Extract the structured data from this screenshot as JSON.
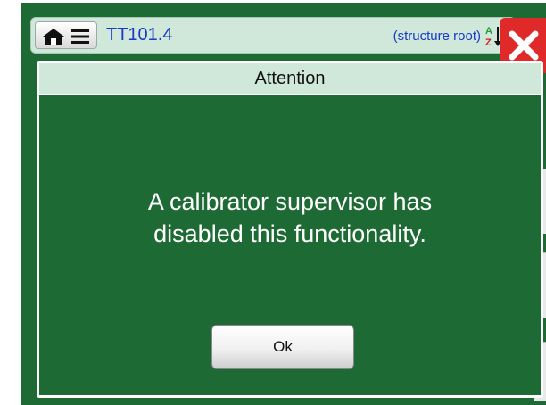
{
  "header": {
    "title": "TT101.4",
    "root_label": "(structure root)",
    "sort_icon_text": "AZ"
  },
  "dialog": {
    "title": "Attention",
    "message_line1": "A calibrator supervisor has",
    "message_line2": "disabled this functionality.",
    "ok_label": "Ok"
  },
  "icons": {
    "home": "home-icon",
    "menu": "menu-icon",
    "sort": "sort-az-icon",
    "close": "close-icon"
  },
  "colors": {
    "background_green": "#1e6a34",
    "bar_mint": "#cfe8d9",
    "title_blue": "#1a39c8",
    "close_red": "#e02a2a"
  }
}
